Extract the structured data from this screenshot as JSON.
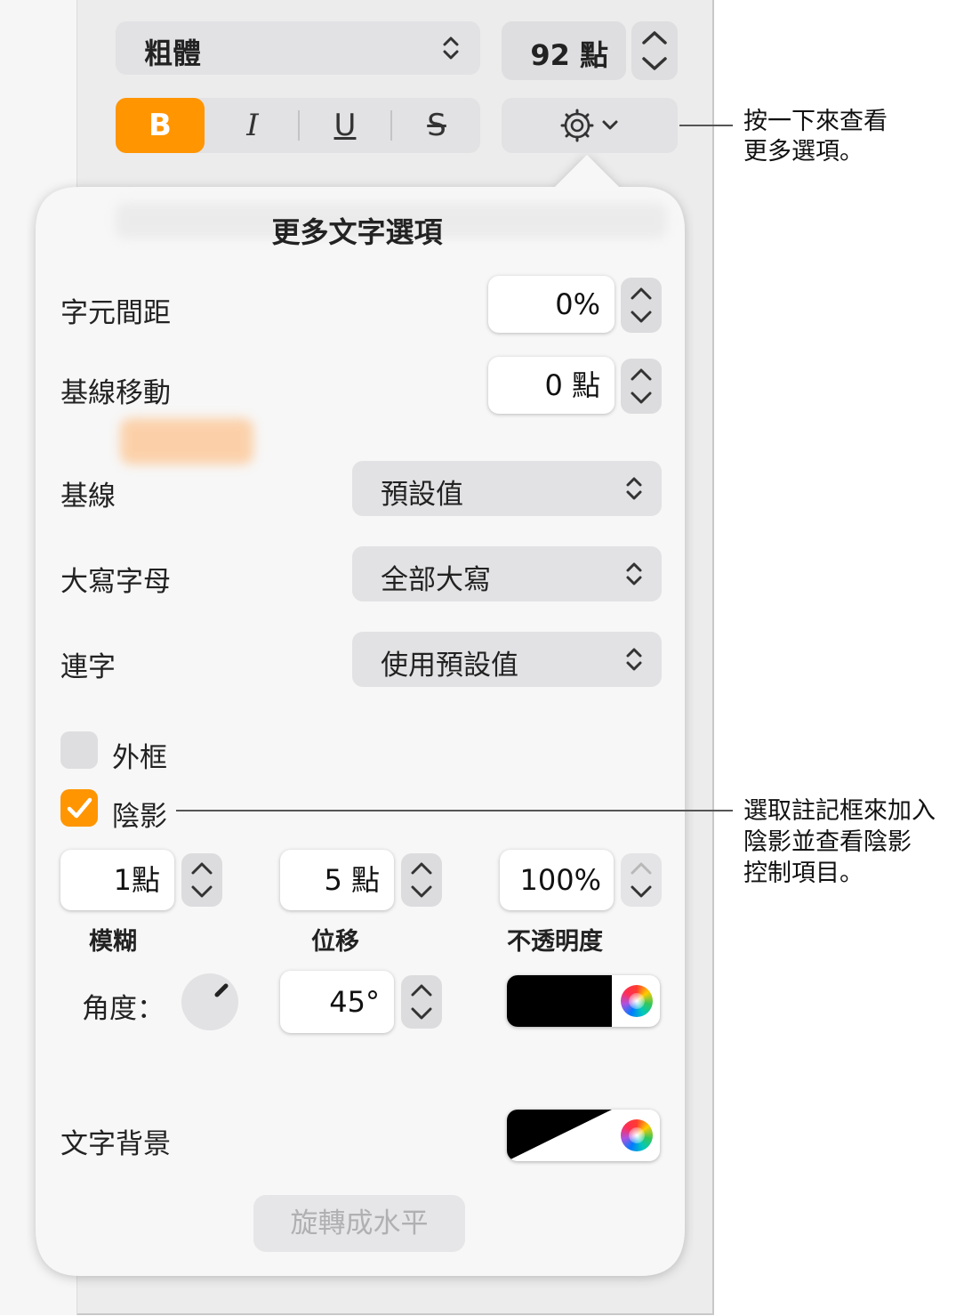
{
  "toolbar": {
    "font_style": "粗體",
    "font_size": "92 點",
    "bold": "B",
    "italic": "I",
    "underline": "U",
    "strike": "S"
  },
  "panel": {
    "title": "更多文字選項",
    "character_spacing": {
      "label": "字元間距",
      "value": "0%"
    },
    "baseline_shift": {
      "label": "基線移動",
      "value": "0 點"
    },
    "baseline": {
      "label": "基線",
      "value": "預設值"
    },
    "capitalization": {
      "label": "大寫字母",
      "value": "全部大寫"
    },
    "ligatures": {
      "label": "連字",
      "value": "使用預設值"
    },
    "outline": {
      "label": "外框",
      "checked": false
    },
    "shadow": {
      "label": "陰影",
      "checked": true,
      "blur": {
        "value": "1點",
        "label": "模糊"
      },
      "offset": {
        "value": "5 點",
        "label": "位移"
      },
      "opacity": {
        "value": "100%",
        "label": "不透明度"
      },
      "angle": {
        "label": "角度：",
        "value": "45°"
      },
      "color": "#000000"
    },
    "text_background": {
      "label": "文字背景"
    },
    "rotate_button": "旋轉成水平"
  },
  "callouts": {
    "more_options": [
      "按一下來查看",
      "更多選項。"
    ],
    "shadow": [
      "選取註記框來加入",
      "陰影並查看陰影",
      "控制項目。"
    ]
  },
  "colors": {
    "accent": "#ff9500",
    "panel_bg": "#f6f6f6",
    "control_bg": "#e2e2e4"
  }
}
